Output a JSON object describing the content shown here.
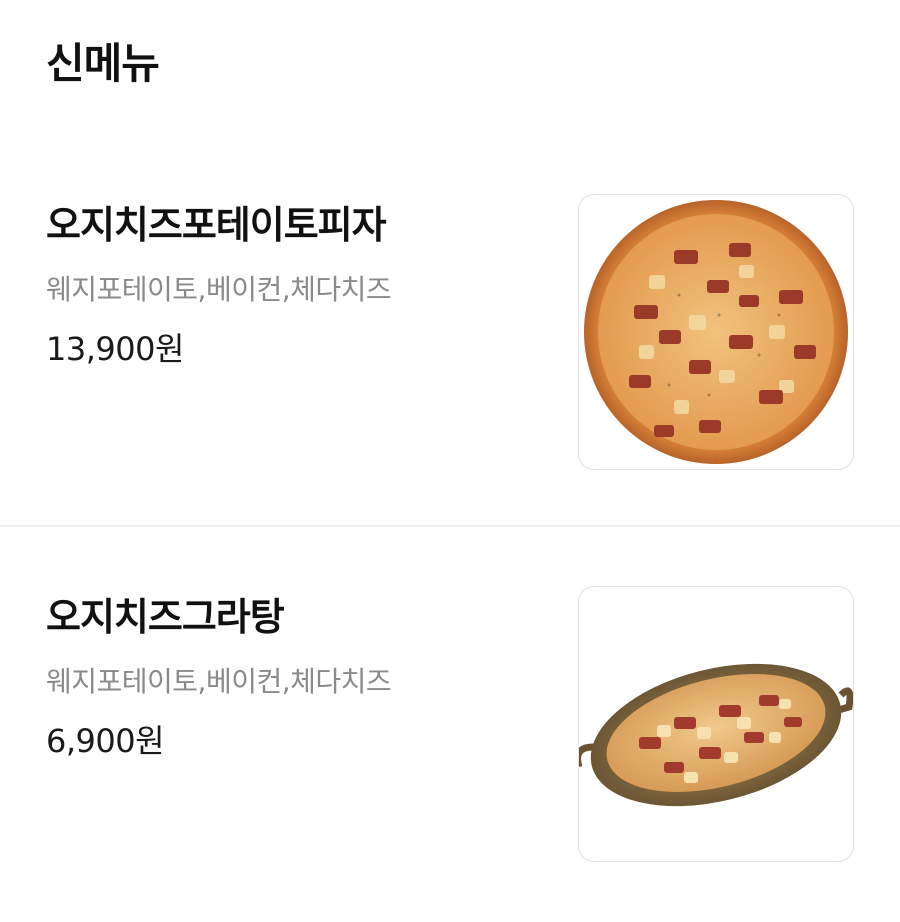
{
  "section": {
    "title": "신메뉴"
  },
  "items": [
    {
      "name": "오지치즈포테이토피자",
      "description": "웨지포테이토,베이컨,체다치즈",
      "price": "13,900원",
      "image_icon": "pizza-image"
    },
    {
      "name": "오지치즈그라탕",
      "description": "웨지포테이토,베이컨,체다치즈",
      "price": "6,900원",
      "image_icon": "gratin-dish-image"
    }
  ],
  "colors": {
    "text_primary": "#111111",
    "text_secondary": "#8a8a8a",
    "divider": "#f0f0f0",
    "thumb_border": "#e2e2e2"
  }
}
